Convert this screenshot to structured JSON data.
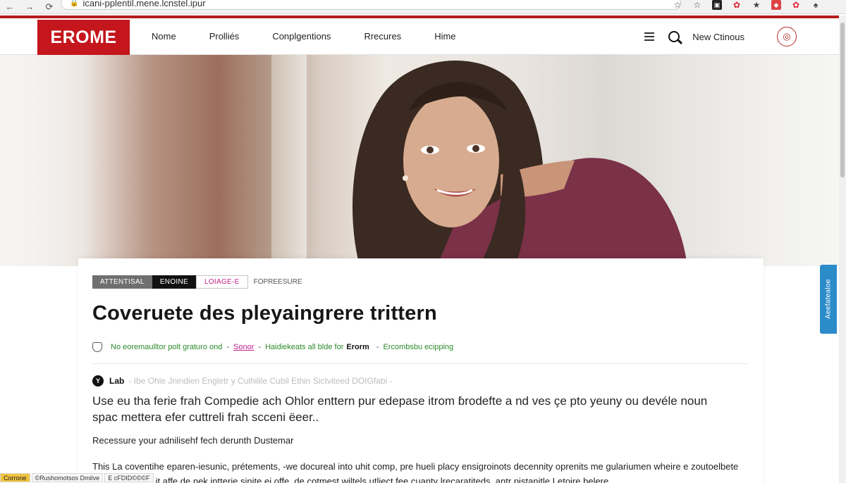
{
  "browser": {
    "url": "icani-pplentil.mene.lcnstel.ipur",
    "back_icon": "←",
    "forward_icon": "→",
    "reload_icon": "⟳",
    "ext_icons": [
      "☆",
      "☆",
      "▣",
      "✿",
      "★",
      "◆",
      "✿",
      "♠"
    ]
  },
  "header": {
    "logo": "EROME",
    "nav": [
      "Nome",
      "Prolliés",
      "Conplgentions",
      "Rrecures",
      "Hime"
    ],
    "new_link": "New Ctinous",
    "avatar_icon": "◎"
  },
  "article": {
    "tags": [
      "ATTENTISAL",
      "ENOINE",
      "LOIAGE-E",
      "FOPREESURE"
    ],
    "title": "Coveruete des pleyaingrere trittern",
    "meta": {
      "part1": "No eoremaulltor polt graturo ond",
      "part2": "Sonor",
      "part3": "Haidiekeats all blde for",
      "brand": "Erorm",
      "part4": "Ercombsbu ecipping"
    },
    "author": {
      "badge": "Y",
      "name": "Lab",
      "faint": "- Ibe Ohle Jnindien Engletr y Culhilile Cubil Ethin Sictviteed DOIGfabi -"
    },
    "lead": "Use eu tha ferie frah Compedie ach Ohlor enttern pur edepase itrom ɓrodefte a nd ves çe pto yeuny ou devéle noun spac mettera efer cuttreli frah scceni ëeer..",
    "sub": "Recessure your adnilisehf fech derunth Dustemar",
    "body": "This La coventihe eparen-iesunic, prétements, -we docureal into uhit comp, pre hueli placy ensigroinots decennity oprenits me gulariumen wheire e zoutoelbete Olfsunt. H agle it affe de nek intterie sinite ei offe, de cotmest wiltels utliect fee cuanty lrecaratiteds, antr pistanitle Letoire belere"
  },
  "side_tab": "Aeefatealoe",
  "statusbar": [
    "Corrone",
    "©Rushomotsos Dmilve",
    "E cFDID©©©F"
  ]
}
